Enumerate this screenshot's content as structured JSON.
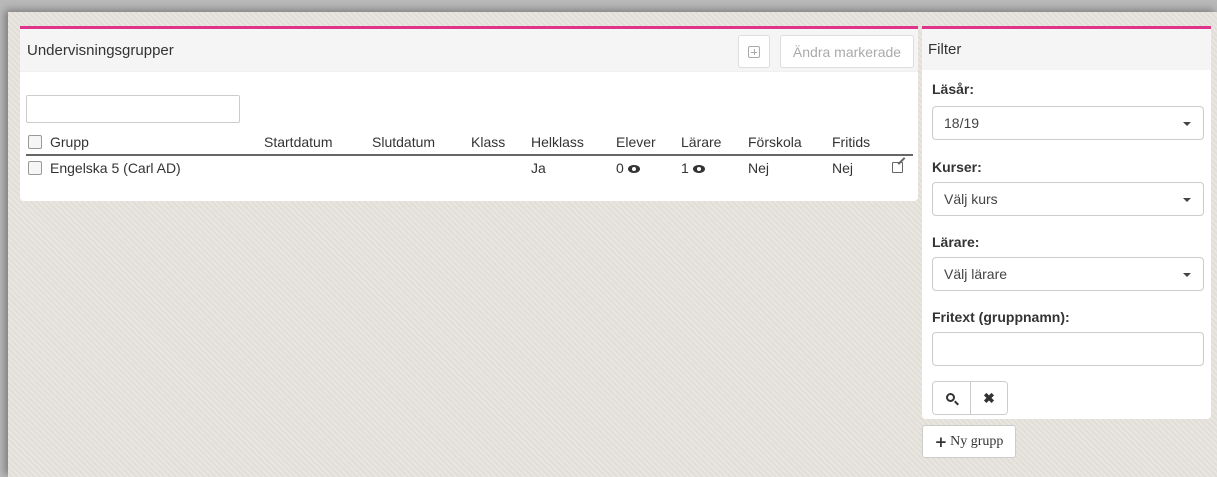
{
  "main": {
    "title": "Undervisningsgrupper",
    "edit_selected_label": "Ändra markerade",
    "search_value": "",
    "columns": [
      "Grupp",
      "Startdatum",
      "Slutdatum",
      "Klass",
      "Helklass",
      "Elever",
      "Lärare",
      "Förskola",
      "Fritids"
    ],
    "rows": [
      {
        "grupp": "Engelska 5 (Carl AD)",
        "startdatum": "",
        "slutdatum": "",
        "klass": "",
        "helklass": "Ja",
        "elever": "0",
        "larare": "1",
        "forskola": "Nej",
        "fritids": "Nej"
      }
    ]
  },
  "filter": {
    "title": "Filter",
    "lasar_label": "Läsår:",
    "lasar_value": "18/19",
    "kurser_label": "Kurser:",
    "kurser_value": "Välj kurs",
    "larare_label": "Lärare:",
    "larare_value": "Välj lärare",
    "fritext_label": "Fritext (gruppnamn):",
    "fritext_value": ""
  },
  "actions": {
    "new_group_label": "Ny grupp"
  },
  "colors": {
    "accent": "#e0338a"
  }
}
